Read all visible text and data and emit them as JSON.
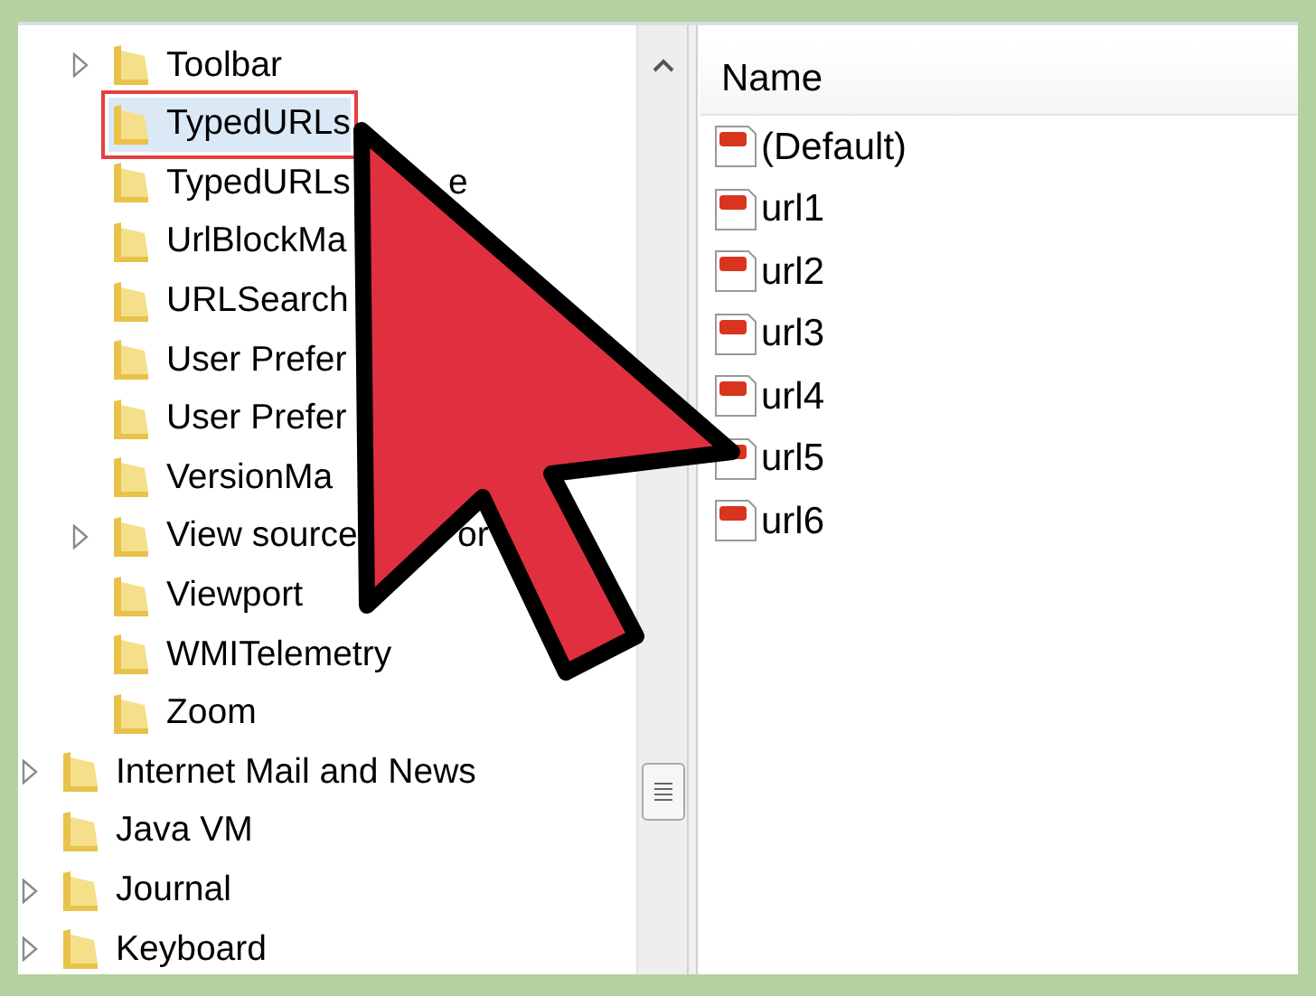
{
  "tree": {
    "subkeys": [
      {
        "label": "Toolbar",
        "expandable": true,
        "selected": false
      },
      {
        "label": "TypedURLs",
        "expandable": false,
        "selected": true
      },
      {
        "label": "TypedURLs",
        "trailing": "e",
        "expandable": false,
        "selected": false
      },
      {
        "label": "UrlBlockMa",
        "expandable": false,
        "selected": false
      },
      {
        "label": "URLSearch",
        "expandable": false,
        "selected": false
      },
      {
        "label": "User Prefer",
        "expandable": false,
        "selected": false
      },
      {
        "label": "User Prefer",
        "expandable": false,
        "selected": false
      },
      {
        "label": "VersionMa",
        "expandable": false,
        "selected": false
      },
      {
        "label": "View source",
        "trailing": "or",
        "expandable": true,
        "selected": false
      },
      {
        "label": "Viewport",
        "expandable": false,
        "selected": false
      },
      {
        "label": "WMITelemetry",
        "expandable": false,
        "selected": false
      },
      {
        "label": "Zoom",
        "expandable": false,
        "selected": false
      }
    ],
    "keys": [
      {
        "label": "Internet Mail and News",
        "expandable": true,
        "selected": false
      },
      {
        "label": "Java VM",
        "expandable": false,
        "selected": false
      },
      {
        "label": "Journal",
        "expandable": true,
        "selected": false
      },
      {
        "label": "Keyboard",
        "expandable": true,
        "selected": false
      }
    ]
  },
  "values": {
    "column": "Name",
    "rows": [
      "(Default)",
      "url1",
      "url2",
      "url3",
      "url4",
      "url5",
      "url6"
    ]
  }
}
